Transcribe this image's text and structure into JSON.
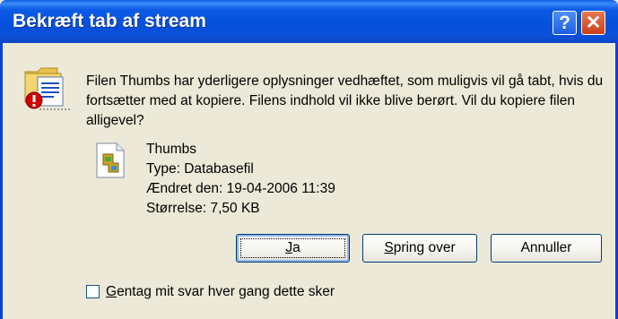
{
  "window": {
    "title": "Bekræft tab af stream",
    "help_glyph": "?",
    "close_glyph": "✕"
  },
  "message": "Filen Thumbs har yderligere oplysninger vedhæftet, som muligvis vil gå tabt, hvis du fortsætter med at kopiere. Filens indhold vil ikke blive berørt. Vil du kopiere filen alligevel?",
  "file": {
    "name": "Thumbs",
    "type": "Type: Databasefil",
    "modified": "Ændret den: 19-04-2006 11:39",
    "size": "Størrelse: 7,50 KB",
    "icon": "database-file-icon"
  },
  "buttons": {
    "yes": {
      "mnemonic": "J",
      "rest": "a"
    },
    "skip": {
      "mnemonic": "S",
      "rest": "pring over"
    },
    "cancel": "Annuller"
  },
  "checkbox": {
    "mnemonic": "G",
    "rest": "entag mit svar hver gang dette sker",
    "checked": false
  },
  "colors": {
    "titlebar": "#0550dc",
    "dialog_bg": "#ece9d8",
    "close_btn": "#d0512b",
    "warning_red": "#d40000"
  }
}
